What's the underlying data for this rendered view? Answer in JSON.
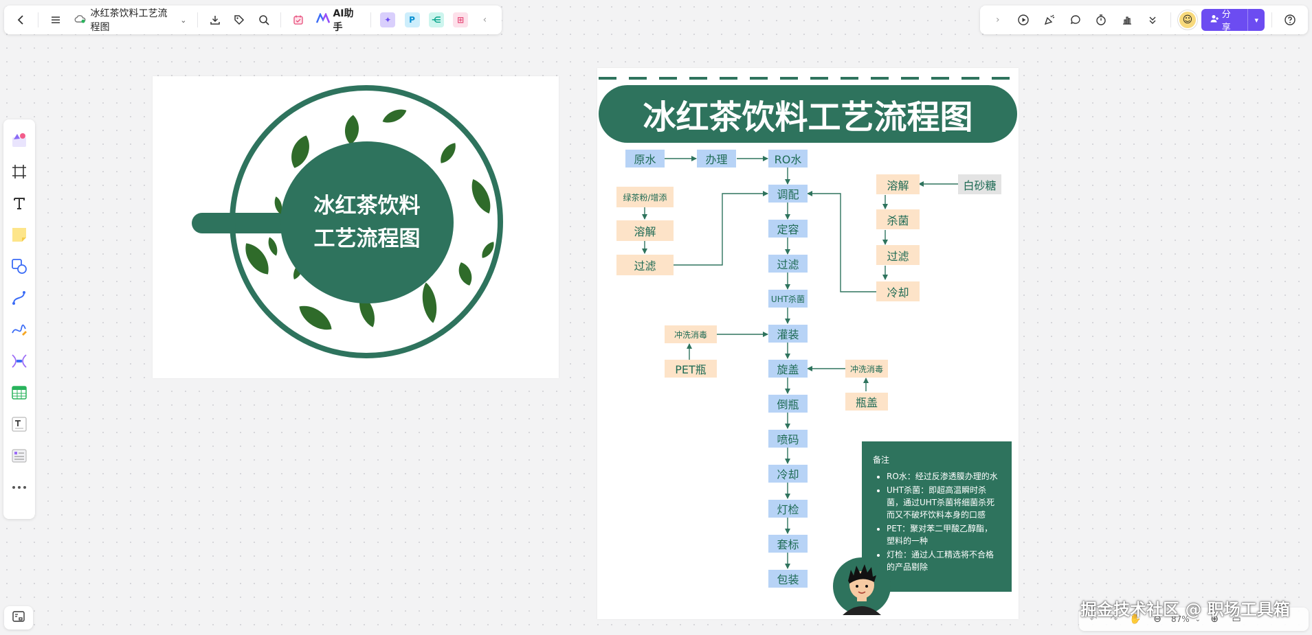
{
  "toolbar_left": {
    "doc_title": "冰红茶饮料工艺流程图",
    "ai_label": "AI助手",
    "tile_p": "P"
  },
  "toolbar_right": {
    "share_label": "分享"
  },
  "poster": {
    "title_line1": "冰红茶饮料",
    "title_line2": "工艺流程图"
  },
  "flowchart": {
    "title": "冰红茶饮料工艺流程图",
    "nodes": {
      "raw_water": "原水",
      "treat": "办理",
      "ro_water": "RO水",
      "mix": "调配",
      "constant": "定容",
      "filter_main": "过滤",
      "uht": "UHT杀菌",
      "fill": "灌装",
      "cap": "旋盖",
      "invert": "倒瓶",
      "code": "喷码",
      "cool_main": "冷却",
      "light_check": "灯检",
      "label": "套标",
      "pack": "包装",
      "tea_powder": "绿茶粉/增添",
      "dissolve_left": "溶解",
      "filter_left": "过滤",
      "dissolve_right": "溶解",
      "sterilize_right": "杀菌",
      "filter_right": "过滤",
      "cool_right": "冷却",
      "sugar": "白砂糖",
      "wash_bottle": "冲洗消毒",
      "pet_bottle": "PET瓶",
      "wash_cap": "冲洗消毒",
      "cap_item": "瓶盖"
    },
    "note": {
      "heading": "备注",
      "items": [
        "RO水：经过反渗透膜办理的水",
        "UHT杀菌：即超高温瞬时杀菌，通过UHT杀菌将细菌杀死而又不破坏饮料本身的口感",
        "PET：聚对苯二甲酸乙醇酯，塑料的一种",
        "灯检：通过人工精选将不合格的产品剔除"
      ]
    }
  },
  "zoom": {
    "level": "87%"
  },
  "watermark": "掘金技术社区 @ 职场工具箱",
  "colors": {
    "brand_green": "#2e735d",
    "leaf_green": "#2f6b2a",
    "node_blue": "#b7d3f6",
    "node_orange": "#fde3c8",
    "accent_purple": "#6c4cf1"
  }
}
